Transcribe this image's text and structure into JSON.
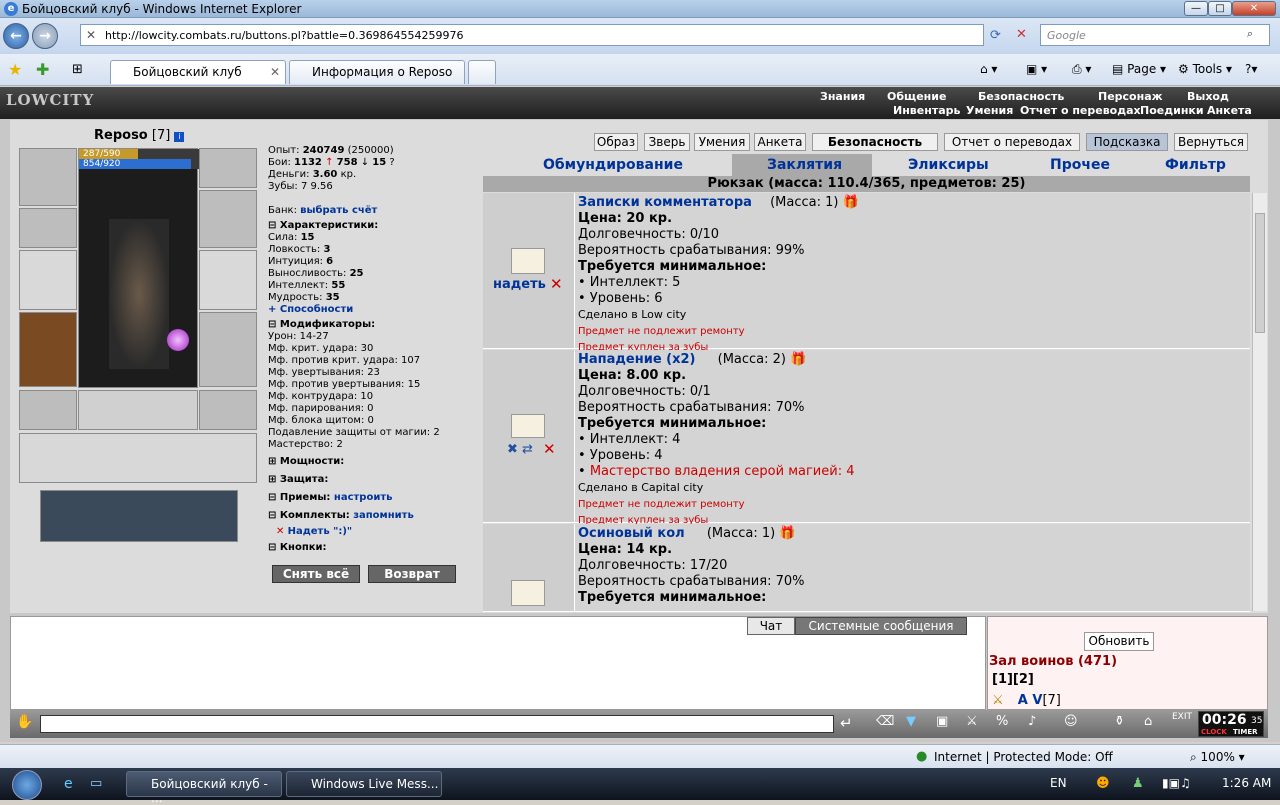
{
  "window": {
    "title": "Бойцовский клуб - Windows Internet Explorer"
  },
  "browser": {
    "url": "http://lowcity.combats.ru/buttons.pl?battle=0.369864554259976",
    "search_placeholder": "Google",
    "tabs": [
      "Бойцовский клуб",
      "Информация о Reposo"
    ],
    "toolbar": {
      "page": "Page",
      "tools": "Tools"
    }
  },
  "game": {
    "logo": "LOWCITY",
    "menu_top": [
      "Знания",
      "Общение",
      "Безопасность",
      "Персонаж",
      "Выход"
    ],
    "menu_bottom": [
      "Инвентарь",
      "Умения",
      "Отчет о переводах",
      "Поединки",
      "Анкета"
    ],
    "character": {
      "name": "Reposo",
      "level": "[7]",
      "hp": "287/590",
      "mp": "854/920"
    },
    "stats": {
      "exp_label": "Опыт:",
      "exp": "240749",
      "exp_next": "(250000)",
      "fights_label": "Бои:",
      "wins": "1132",
      "losses": "758",
      "draws": "15",
      "money_label": "Деньги:",
      "money": "3.60",
      "money_unit": "кр.",
      "teeth_label": "Зубы:",
      "teeth": "7 9.56",
      "bank_label": "Банк:",
      "bank_link": "выбрать счёт",
      "chars_header": "Характеристики:",
      "chars": [
        {
          "k": "Сила:",
          "v": "15"
        },
        {
          "k": "Ловкость:",
          "v": "3"
        },
        {
          "k": "Интуиция:",
          "v": "6"
        },
        {
          "k": "Выносливость:",
          "v": "25"
        },
        {
          "k": "Интеллект:",
          "v": "55"
        },
        {
          "k": "Мудрость:",
          "v": "35"
        }
      ],
      "abilities": "+ Способности",
      "mods_header": "Модификаторы:",
      "mods": [
        "Урон: 14-27",
        "Мф. крит. удара: 30",
        "Мф. против крит. удара: 107",
        "Мф. увертывания: 23",
        "Мф. против увертывания: 15",
        "Мф. контрудара: 10",
        "Мф. парирования: 0",
        "Мф. блока щитом: 0",
        "Подавление защиты от магии: 2",
        "Мастерство: 2"
      ],
      "power": "Мощности:",
      "defense": "Защита:",
      "tricks": "Приемы:",
      "tricks_link": "настроить",
      "sets": "Комплекты:",
      "sets_link": "запомнить",
      "put_on": "Надеть \":)\"",
      "buttons": "Кнопки:"
    },
    "remove_all": "Снять всё",
    "return_btn": "Возврат",
    "top_buttons": [
      "Образ",
      "Зверь",
      "Умения",
      "Анкета",
      "Безопасность",
      "Отчет о переводах",
      "Подсказка",
      "Вернуться"
    ],
    "categories": [
      "Обмундирование",
      "Заклятия",
      "Эликсиры",
      "Прочее",
      "Фильтр"
    ],
    "backpack": "Рюкзак (масса: 110.4/365, предметов: 25)",
    "items": [
      {
        "name": "Записки комментатора",
        "mass": "(Масса: 1)",
        "action": "надеть",
        "price": "Цена: 20 кр.",
        "durability": "Долговечность: 0/10",
        "chance": "Вероятность срабатывания: 99%",
        "req_header": "Требуется минимальное:",
        "reqs": [
          "• Интеллект: 5",
          "• Уровень: 6"
        ],
        "req_red": "",
        "made": "Сделано в Low city",
        "note1": "Предмет не подлежит ремонту",
        "note2": "Предмет куплен за зубы"
      },
      {
        "name": "Нападение (x2)",
        "mass": "(Масса: 2)",
        "action": "",
        "price": "Цена: 8.00 кр.",
        "durability": "Долговечность: 0/1",
        "chance": "Вероятность срабатывания: 70%",
        "req_header": "Требуется минимальное:",
        "reqs": [
          "• Интеллект: 4",
          "• Уровень: 4"
        ],
        "req_red": "Мастерство владения серой магией: 4",
        "made": "Сделано в Capital city",
        "note1": "Предмет не подлежит ремонту",
        "note2": "Предмет куплен за зубы"
      },
      {
        "name": "Осиновый кол",
        "mass": "(Масса: 1)",
        "action": "",
        "price": "Цена: 14 кр.",
        "durability": "Долговечность: 17/20",
        "chance": "Вероятность срабатывания: 70%",
        "req_header": "Требуется минимальное:"
      }
    ],
    "chat_tabs": [
      "Чат",
      "Системные сообщения"
    ],
    "refresh": "Обновить",
    "hall": "Зал воинов (471)",
    "pages": "[1][2]",
    "player": "A V",
    "player_level": "[7]",
    "clock": "00:26",
    "clock_sec": "35",
    "clock_label1": "CLOCK",
    "clock_label2": "TIMER"
  },
  "status": {
    "zone": "Internet | Protected Mode: Off",
    "zoom": "100%"
  },
  "taskbar": {
    "items": [
      "Бойцовский клуб - ...",
      "Windows Live Mess..."
    ],
    "lang": "EN",
    "time": "1:26 AM"
  }
}
